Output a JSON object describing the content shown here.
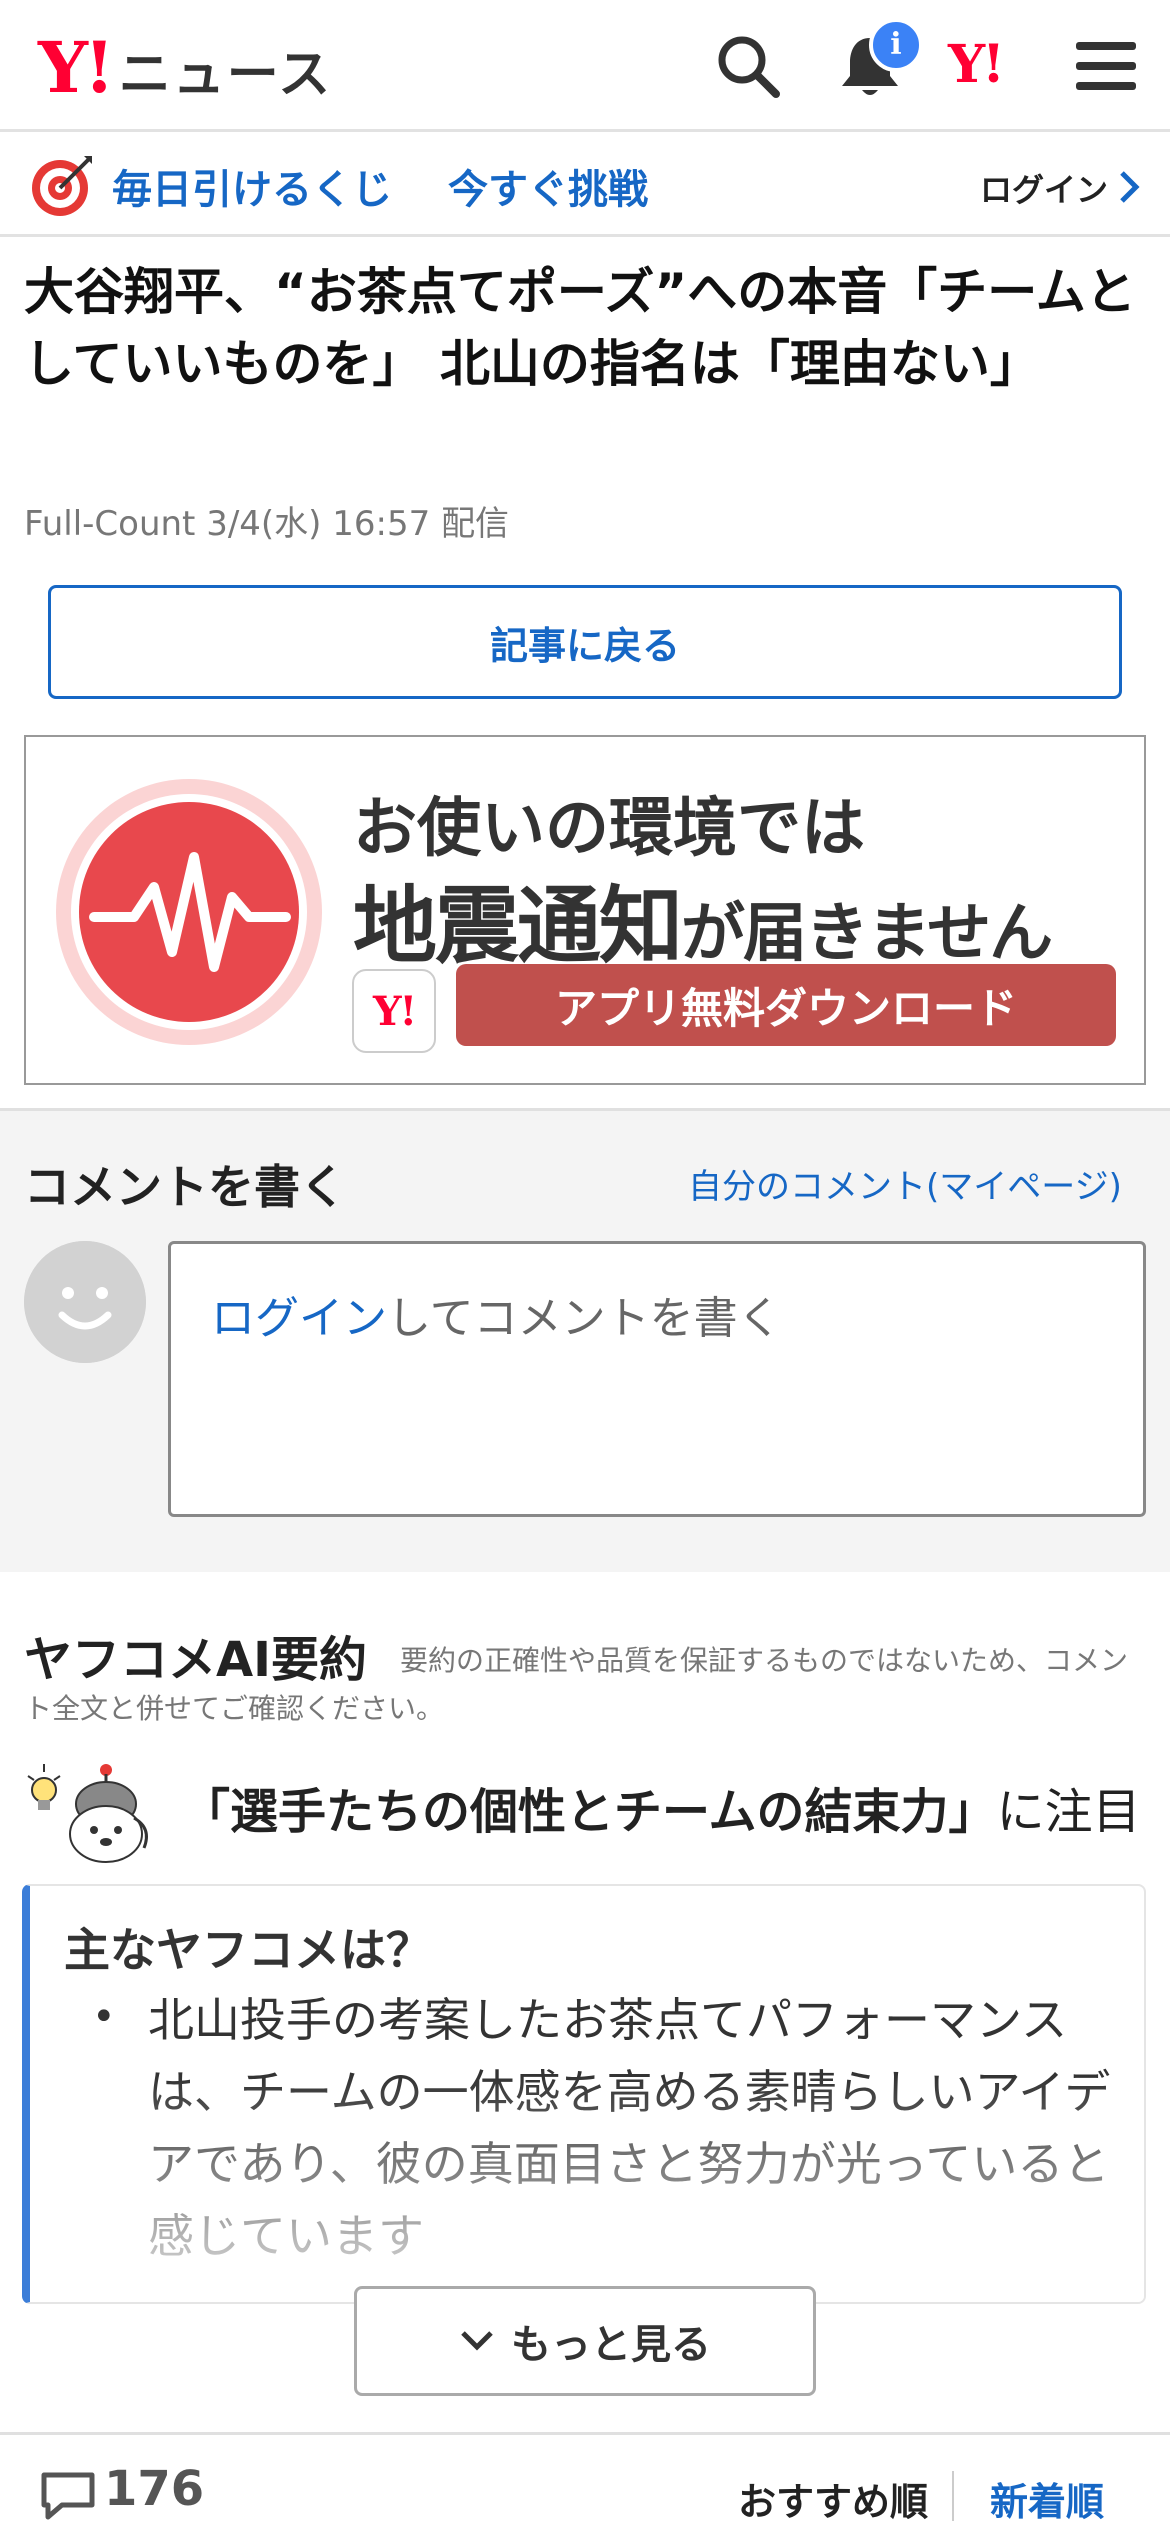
{
  "header": {
    "logo_mark": "Y!",
    "logo_text": "ニュース",
    "notification_count": "i",
    "yahoo_mark": "Y!",
    "icons": [
      "search-icon",
      "bell-icon",
      "yahoo-logo-icon",
      "menu-icon"
    ]
  },
  "lottery": {
    "text1": "毎日引けるくじ",
    "text2": "今すぐ挑戦",
    "login": "ログイン",
    "icon": "target-icon"
  },
  "article": {
    "title": "大谷翔平、“お茶点てポーズ”への本音「チームとしていいものを」 北山の指名は「理由ない」",
    "source": "Full-Count",
    "date": "3/4(水) 16:57",
    "delivered": "配信",
    "back_button": "記事に戻る"
  },
  "ad": {
    "line1": "お使いの環境では",
    "line2_big": "地震通知",
    "line2_small": "が届きません",
    "app_logo": "Y!",
    "cta": "アプリ無料ダウンロード",
    "colors": {
      "accent": "#e8484d",
      "button": "#c0504d"
    }
  },
  "comment": {
    "title": "コメントを書く",
    "mypage_link": "自分のコメント(マイページ)",
    "login_link": "ログイン",
    "placeholder_rest": "してコメントを書く"
  },
  "ai": {
    "title": "ヤフコメAI要約",
    "note": "要約の正確性や品質を保証するものではないため、コメント全文と併せてご確認ください。",
    "highlight": "「選手たちの個性とチームの結束力」",
    "highlight_suffix": "に注目",
    "card_title": "主なヤフコメは？",
    "bullet": "北山投手の考案したお茶点てパフォーマンスは、チームの一体感を高める素晴らしいアイデアであり、彼の真面目さと努力が光っていると感じています",
    "more_button": "もっと見る"
  },
  "bottom": {
    "comment_count": "176",
    "sort_recommended": "おすすめ順",
    "sort_newest": "新着順"
  },
  "colors": {
    "brand": "#ff0033",
    "link": "#1667c5"
  }
}
